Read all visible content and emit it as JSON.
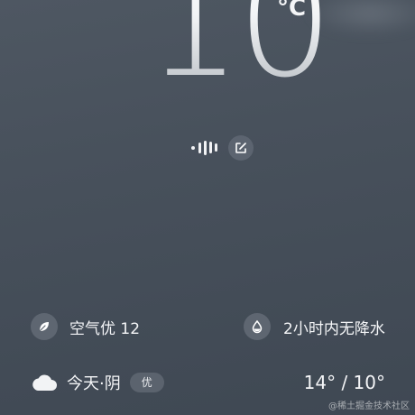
{
  "current": {
    "temperature": "10",
    "unit": "°C"
  },
  "controls": {
    "voice_icon": "voice-wave-icon",
    "edit_icon": "edit-icon"
  },
  "air_quality": {
    "icon": "leaf-icon",
    "label": "空气优 12"
  },
  "precipitation": {
    "icon": "water-drop-icon",
    "label": "2小时内无降水"
  },
  "today": {
    "icon": "cloud-icon",
    "label": "今天·阴",
    "aqi_badge": "优",
    "range": "14° / 10°"
  },
  "watermark": "@稀土掘金技术社区",
  "colors": {
    "background_top": "#4e5762",
    "background_bottom": "#3f4853",
    "icon_circle": "#5e6671",
    "text": "#f4f5f7"
  }
}
